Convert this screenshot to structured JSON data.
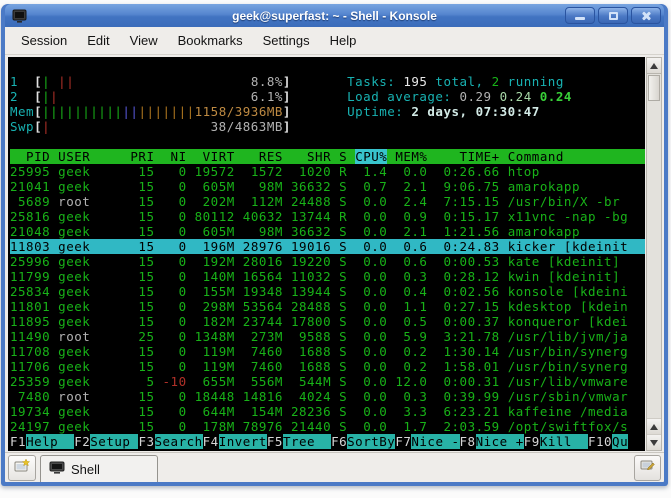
{
  "window": {
    "title": "geek@superfast: ~ - Shell - Konsole",
    "controls": [
      {
        "name": "minimize"
      },
      {
        "name": "maximize"
      },
      {
        "name": "close"
      }
    ]
  },
  "menu": {
    "items": [
      "Session",
      "Edit",
      "View",
      "Bookmarks",
      "Settings",
      "Help"
    ]
  },
  "terminal": {
    "colors": {
      "green": "#18B218",
      "cyan": "#18B2B2",
      "gray": "#B2B2B2",
      "white": "#E8E8E8",
      "red": "#B03028",
      "blue": "#5858D8",
      "orange": "#B07820",
      "tan": "#BE8A42",
      "palegreen": "#A8D8A8",
      "brightgreen": "#38D038",
      "palecyan": "#D2EAE6",
      "bracket": "#E2E2E2",
      "headerbg": "#1FB51F",
      "sortbg": "#38C4CC",
      "selbg": "#30B8C4",
      "fkeybg": "#28B2A6",
      "background": "#000000"
    },
    "meter_width": 30,
    "info_column": 42,
    "line_width": 78,
    "header_lines": [
      {
        "name": "cpu1-meter",
        "label": "1  ",
        "bar": [
          {
            "t": "|",
            "c": "green"
          },
          {
            "t": " ",
            "c": "green"
          },
          {
            "t": "||",
            "c": "red"
          }
        ],
        "value": "8.8%",
        "value_color": "gray",
        "info_name": "tasks-line",
        "info": [
          {
            "t": "Tasks: ",
            "c": "cyan"
          },
          {
            "t": "195",
            "c": "white"
          },
          {
            "t": " total, ",
            "c": "cyan"
          },
          {
            "t": "2",
            "c": "green"
          },
          {
            "t": " running",
            "c": "cyan"
          }
        ]
      },
      {
        "name": "cpu2-meter",
        "label": "2  ",
        "bar": [
          {
            "t": "|",
            "c": "green"
          },
          {
            "t": "|",
            "c": "red"
          }
        ],
        "value": "6.1%",
        "value_color": "gray",
        "info_name": "load-average-line",
        "info": [
          {
            "t": "Load average: ",
            "c": "cyan"
          },
          {
            "t": "0.29 ",
            "c": "gray"
          },
          {
            "t": "0.24 ",
            "c": "palegreen"
          },
          {
            "t": "0.24",
            "c": "brightgreen",
            "b": 1
          }
        ]
      },
      {
        "name": "mem-meter",
        "label": "Mem",
        "bar": [
          {
            "t": "||||||||||",
            "c": "green"
          },
          {
            "t": "||",
            "c": "blue"
          },
          {
            "t": "|||||||",
            "c": "orange"
          }
        ],
        "value": "1158/3936MB",
        "value_color": "tan",
        "info_name": "uptime-line",
        "info": [
          {
            "t": "Uptime: ",
            "c": "cyan"
          },
          {
            "t": "2 days, 07:30:47",
            "c": "palecyan",
            "b": 1
          }
        ]
      },
      {
        "name": "swp-meter",
        "label": "Swp",
        "bar": [
          {
            "t": "|",
            "c": "red"
          }
        ],
        "value": "38/4863MB",
        "value_color": "gray"
      }
    ],
    "table": {
      "sort_column": "CPU%",
      "columns": [
        {
          "key": "pid",
          "label": "PID",
          "w": 5,
          "right": true
        },
        {
          "key": "user",
          "label": "USER",
          "w": 9,
          "right": false,
          "pre": " "
        },
        {
          "key": "pri",
          "label": "PRI",
          "w": 3,
          "right": true
        },
        {
          "key": "ni",
          "label": "NI",
          "w": 3,
          "right": true,
          "pre": " "
        },
        {
          "key": "virt",
          "label": "VIRT",
          "w": 5,
          "right": true,
          "pre": " "
        },
        {
          "key": "res",
          "label": "RES",
          "w": 5,
          "right": true,
          "pre": " "
        },
        {
          "key": "shr",
          "label": "SHR",
          "w": 5,
          "right": true,
          "pre": " "
        },
        {
          "key": "s",
          "label": "S",
          "w": 1,
          "right": false,
          "pre": " "
        },
        {
          "key": "cpu",
          "label": "CPU%",
          "w": 4,
          "right": true,
          "pre": " "
        },
        {
          "key": "mem",
          "label": "MEM%",
          "w": 4,
          "right": true,
          "pre": " "
        },
        {
          "key": "time",
          "label": "TIME+",
          "w": 8,
          "right": true,
          "pre": " "
        },
        {
          "key": "cmd",
          "label": "Command",
          "w": 16,
          "right": false,
          "pre": " "
        }
      ],
      "rows": [
        {
          "pid": "25995",
          "user": "geek",
          "pri": "15",
          "ni": "0",
          "virt": "19572",
          "res": "1572",
          "shr": "1020",
          "s": "R",
          "cpu": "1.4",
          "mem": "0.0",
          "time": "0:26.66",
          "cmd": "htop"
        },
        {
          "pid": "21041",
          "user": "geek",
          "pri": "15",
          "ni": "0",
          "virt": "605M",
          "res": "98M",
          "shr": "36632",
          "s": "S",
          "cpu": "0.7",
          "mem": "2.1",
          "time": "9:06.75",
          "cmd": "amarokapp"
        },
        {
          "pid": "5689",
          "user": "root",
          "pri": "15",
          "ni": "0",
          "virt": "202M",
          "res": "112M",
          "shr": "24488",
          "s": "S",
          "cpu": "0.0",
          "mem": "2.4",
          "time": "7:15.15",
          "cmd": "/usr/bin/X -br"
        },
        {
          "pid": "25816",
          "user": "geek",
          "pri": "15",
          "ni": "0",
          "virt": "80112",
          "res": "40632",
          "shr": "13744",
          "s": "R",
          "cpu": "0.0",
          "mem": "0.9",
          "time": "0:15.17",
          "cmd": "x11vnc -nap -bg"
        },
        {
          "pid": "21048",
          "user": "geek",
          "pri": "15",
          "ni": "0",
          "virt": "605M",
          "res": "98M",
          "shr": "36632",
          "s": "S",
          "cpu": "0.0",
          "mem": "2.1",
          "time": "1:21.56",
          "cmd": "amarokapp"
        },
        {
          "pid": "11803",
          "user": "geek",
          "pri": "15",
          "ni": "0",
          "virt": "196M",
          "res": "28976",
          "shr": "19016",
          "s": "S",
          "cpu": "0.0",
          "mem": "0.6",
          "time": "0:24.83",
          "cmd": "kicker [kdeinit",
          "selected": true
        },
        {
          "pid": "25996",
          "user": "geek",
          "pri": "15",
          "ni": "0",
          "virt": "192M",
          "res": "28016",
          "shr": "19220",
          "s": "S",
          "cpu": "0.0",
          "mem": "0.6",
          "time": "0:00.53",
          "cmd": "kate [kdeinit]"
        },
        {
          "pid": "11799",
          "user": "geek",
          "pri": "15",
          "ni": "0",
          "virt": "140M",
          "res": "16564",
          "shr": "11032",
          "s": "S",
          "cpu": "0.0",
          "mem": "0.3",
          "time": "0:28.12",
          "cmd": "kwin [kdeinit]"
        },
        {
          "pid": "25834",
          "user": "geek",
          "pri": "15",
          "ni": "0",
          "virt": "155M",
          "res": "19348",
          "shr": "13944",
          "s": "S",
          "cpu": "0.0",
          "mem": "0.4",
          "time": "0:02.56",
          "cmd": "konsole [kdeini"
        },
        {
          "pid": "11801",
          "user": "geek",
          "pri": "15",
          "ni": "0",
          "virt": "298M",
          "res": "53564",
          "shr": "28488",
          "s": "S",
          "cpu": "0.0",
          "mem": "1.1",
          "time": "0:27.15",
          "cmd": "kdesktop [kdein"
        },
        {
          "pid": "11895",
          "user": "geek",
          "pri": "15",
          "ni": "0",
          "virt": "182M",
          "res": "23744",
          "shr": "17800",
          "s": "S",
          "cpu": "0.0",
          "mem": "0.5",
          "time": "0:00.37",
          "cmd": "konqueror [kdei"
        },
        {
          "pid": "11490",
          "user": "root",
          "pri": "25",
          "ni": "0",
          "virt": "1348M",
          "res": "273M",
          "shr": "9588",
          "s": "S",
          "cpu": "0.0",
          "mem": "5.9",
          "time": "3:21.78",
          "cmd": "/usr/lib/jvm/ja"
        },
        {
          "pid": "11708",
          "user": "geek",
          "pri": "15",
          "ni": "0",
          "virt": "119M",
          "res": "7460",
          "shr": "1688",
          "s": "S",
          "cpu": "0.0",
          "mem": "0.2",
          "time": "1:30.14",
          "cmd": "/usr/bin/synerg"
        },
        {
          "pid": "11706",
          "user": "geek",
          "pri": "15",
          "ni": "0",
          "virt": "119M",
          "res": "7460",
          "shr": "1688",
          "s": "S",
          "cpu": "0.0",
          "mem": "0.2",
          "time": "1:58.01",
          "cmd": "/usr/bin/synerg"
        },
        {
          "pid": "25359",
          "user": "geek",
          "pri": "5",
          "ni": "-10",
          "virt": "655M",
          "res": "556M",
          "shr": "544M",
          "s": "S",
          "cpu": "0.0",
          "mem": "12.0",
          "time": "0:00.31",
          "cmd": "/usr/lib/vmware"
        },
        {
          "pid": "7480",
          "user": "root",
          "pri": "15",
          "ni": "0",
          "virt": "18448",
          "res": "14816",
          "shr": "4024",
          "s": "S",
          "cpu": "0.0",
          "mem": "0.3",
          "time": "0:39.99",
          "cmd": "/usr/sbin/vmwar"
        },
        {
          "pid": "19734",
          "user": "geek",
          "pri": "15",
          "ni": "0",
          "virt": "644M",
          "res": "154M",
          "shr": "28236",
          "s": "S",
          "cpu": "0.0",
          "mem": "3.3",
          "time": "6:23.21",
          "cmd": "kaffeine /media"
        },
        {
          "pid": "24197",
          "user": "geek",
          "pri": "15",
          "ni": "0",
          "virt": "178M",
          "res": "78976",
          "shr": "21440",
          "s": "S",
          "cpu": "0.0",
          "mem": "1.7",
          "time": "2:03.59",
          "cmd": "/opt/swiftfox/s"
        }
      ]
    },
    "fkeys": [
      {
        "key": "F1",
        "label": "Help  "
      },
      {
        "key": "F2",
        "label": "Setup "
      },
      {
        "key": "F3",
        "label": "Search"
      },
      {
        "key": "F4",
        "label": "Invert"
      },
      {
        "key": "F5",
        "label": "Tree  "
      },
      {
        "key": "F6",
        "label": "SortBy"
      },
      {
        "key": "F7",
        "label": "Nice -"
      },
      {
        "key": "F8",
        "label": "Nice +"
      },
      {
        "key": "F9",
        "label": "Kill  "
      },
      {
        "key": "F10",
        "label": "Qu"
      }
    ]
  },
  "tabbar": {
    "tab_label": "Shell"
  }
}
